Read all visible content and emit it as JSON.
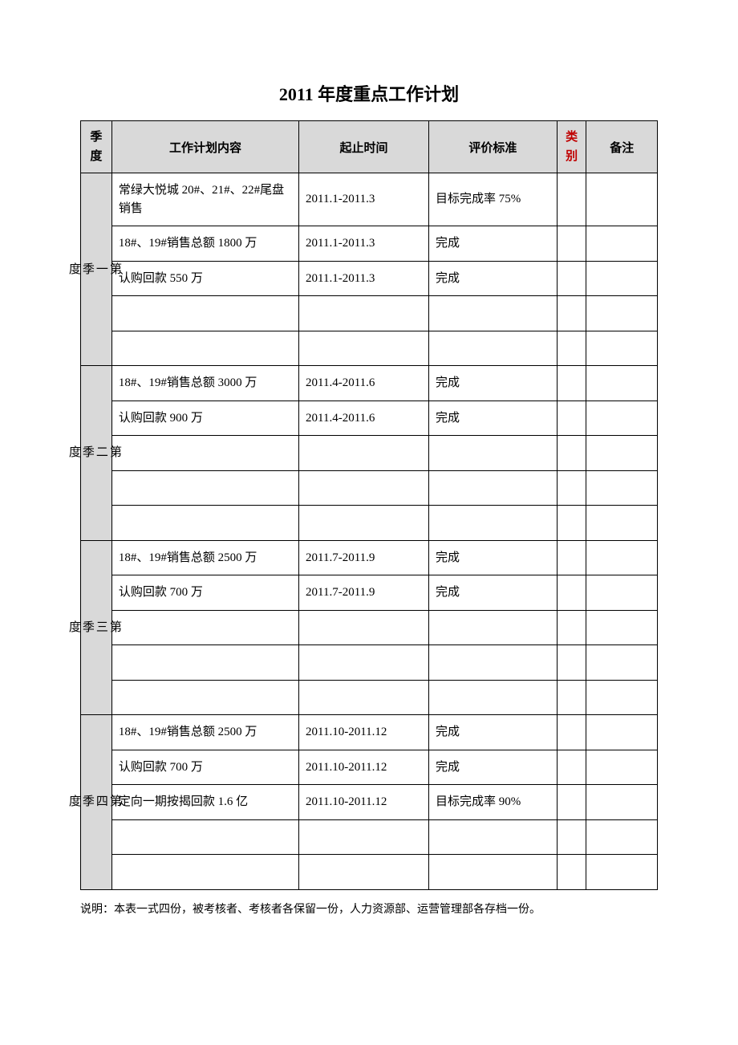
{
  "title": "2011 年度重点工作计划",
  "headers": {
    "quarter": "季度",
    "content": "工作计划内容",
    "time": "起止时间",
    "eval": "评价标准",
    "type": "类别",
    "remark": "备注"
  },
  "quarters": [
    {
      "label": "第一季度",
      "rows": [
        {
          "content": "常绿大悦城 20#、21#、22#尾盘销售",
          "time": "2011.1-2011.3",
          "eval": "目标完成率 75%",
          "type": "",
          "remark": ""
        },
        {
          "content": "18#、19#销售总额 1800 万",
          "time": "2011.1-2011.3",
          "eval": "完成",
          "type": "",
          "remark": ""
        },
        {
          "content": "认购回款 550 万",
          "time": "2011.1-2011.3",
          "eval": "完成",
          "type": "",
          "remark": ""
        },
        {
          "content": "",
          "time": "",
          "eval": "",
          "type": "",
          "remark": ""
        },
        {
          "content": "",
          "time": "",
          "eval": "",
          "type": "",
          "remark": ""
        }
      ]
    },
    {
      "label": "第二季度",
      "rows": [
        {
          "content": "18#、19#销售总额 3000 万",
          "time": "2011.4-2011.6",
          "eval": "完成",
          "type": "",
          "remark": ""
        },
        {
          "content": "认购回款 900 万",
          "time": "2011.4-2011.6",
          "eval": "完成",
          "type": "",
          "remark": ""
        },
        {
          "content": "",
          "time": "",
          "eval": "",
          "type": "",
          "remark": ""
        },
        {
          "content": "",
          "time": "",
          "eval": "",
          "type": "",
          "remark": ""
        },
        {
          "content": "",
          "time": "",
          "eval": "",
          "type": "",
          "remark": ""
        }
      ]
    },
    {
      "label": "第三季度",
      "rows": [
        {
          "content": "18#、19#销售总额 2500 万",
          "time": "2011.7-2011.9",
          "eval": "完成",
          "type": "",
          "remark": ""
        },
        {
          "content": "认购回款 700 万",
          "time": "2011.7-2011.9",
          "eval": "完成",
          "type": "",
          "remark": ""
        },
        {
          "content": "",
          "time": "",
          "eval": "",
          "type": "",
          "remark": ""
        },
        {
          "content": "",
          "time": "",
          "eval": "",
          "type": "",
          "remark": ""
        },
        {
          "content": "",
          "time": "",
          "eval": "",
          "type": "",
          "remark": ""
        }
      ]
    },
    {
      "label": "第四季度",
      "rows": [
        {
          "content": "18#、19#销售总额 2500 万",
          "time": "2011.10-2011.12",
          "eval": "完成",
          "type": "",
          "remark": ""
        },
        {
          "content": "认购回款 700 万",
          "time": "2011.10-2011.12",
          "eval": "完成",
          "type": "",
          "remark": ""
        },
        {
          "content": "定向一期按揭回款 1.6 亿",
          "time": "2011.10-2011.12",
          "eval": "目标完成率 90%",
          "type": "",
          "remark": ""
        },
        {
          "content": "",
          "time": "",
          "eval": "",
          "type": "",
          "remark": ""
        },
        {
          "content": "",
          "time": "",
          "eval": "",
          "type": "",
          "remark": ""
        }
      ]
    }
  ],
  "footnote": "说明：本表一式四份，被考核者、考核者各保留一份，人力资源部、运营管理部各存档一份。"
}
